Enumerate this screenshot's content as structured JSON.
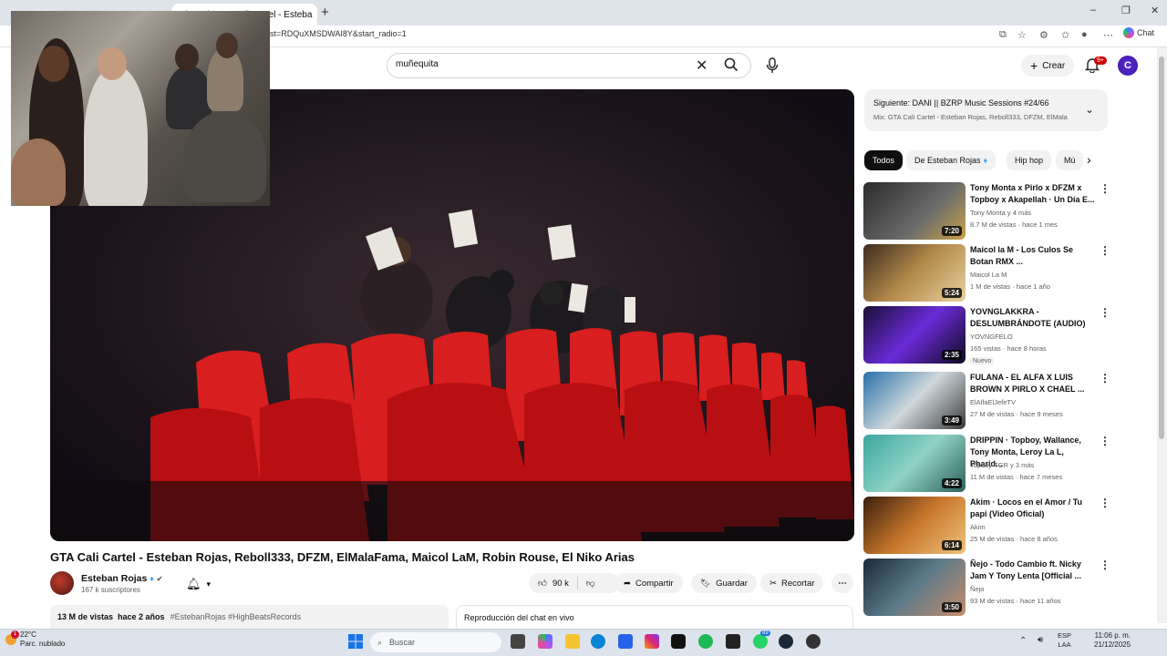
{
  "browser": {
    "tabs": [
      {
        "label": "...",
        "active": false
      },
      {
        "label": "(2137) GTA Cali Cartel - Esteba",
        "active": true
      }
    ],
    "url": "st=RDQuXMSDWAI8Y&start_radio=1",
    "chat_label": "Chat"
  },
  "youtube": {
    "search": {
      "value": "muñequita"
    },
    "create_label": "Crear",
    "notif_count": "9+",
    "avatar_letter": "C"
  },
  "video": {
    "title": "GTA Cali Cartel - Esteban Rojas, Reboll333, DFZM, ElMalaFama, Maicol LaM, Robin Rouse, El Niko Arias",
    "channel": "Esteban Rojas",
    "subscribers": "167 k suscriptores",
    "likes": "90 k",
    "share_label": "Compartir",
    "save_label": "Guardar",
    "clip_label": "Recortar",
    "views_date": "13 M de vistas  hace 2 años",
    "hashtags": "#EstebanRojas #HighBeatsRecords",
    "chat_replay": "Reproducción del chat en vivo"
  },
  "upnext": {
    "title": "Siguiente: DANI || BZRP Music Sessions #24/66",
    "subtitle": "Mix: GTA Cali Cartel - Esteban Rojas, Reboll333, DFZM, ElMala"
  },
  "chips": [
    "Todos",
    "De Esteban Rojas",
    "Hip hop",
    "Mú"
  ],
  "related": [
    {
      "title": "Tony Monta x Pirlo x DFZM x Topboy x Akapellah · Un Día E...",
      "channel": "Tony Monta  y 4 más",
      "meta": "8.7 M de vistas · hace 1 mes",
      "duration": "7:20",
      "badge": ""
    },
    {
      "title": "Maicol la M - Los Culos Se Botan RMX ...",
      "channel": "Maicol La M",
      "meta": "1 M de vistas · hace 1 año",
      "duration": "5:24",
      "badge": ""
    },
    {
      "title": "YOVNGLAKKRA - DESLUMBRÁNDOTE (AUDIO)",
      "channel": "YOVNGFELO",
      "meta": "165 vistas · hace 8 horas",
      "duration": "2:35",
      "badge": "Nuevo"
    },
    {
      "title": "FULANA - EL ALFA X LUIS BROWN X PIRLO X CHAEL ...",
      "channel": "ElAlfaElJefeTV",
      "meta": "27 M de vistas · hace 9 meses",
      "duration": "3:49",
      "badge": ""
    },
    {
      "title": "DRIPPIN · Topboy, Wallance, Tony Monta, Leroy La L, Pharid...",
      "channel": "Topboy TGR  y 3 más",
      "meta": "11 M de vistas · hace 7 meses",
      "duration": "4:22",
      "badge": ""
    },
    {
      "title": "Akim · Locos en el Amor / Tu papi (Video Oficial)",
      "channel": "Akim",
      "meta": "25 M de vistas · hace 8 años",
      "duration": "6:14",
      "badge": ""
    },
    {
      "title": "Ñejo - Todo Cambio ft. Nicky Jam Y Tony Lenta [Official ...",
      "channel": "Ñejo",
      "meta": "93 M de vistas · hace 11 años",
      "duration": "3:50",
      "badge": ""
    }
  ],
  "taskbar": {
    "weather_temp": "22°C",
    "weather_desc": "Parc. nublado",
    "search_placeholder": "Buscar",
    "lang": "ESP",
    "lang2": "LAA",
    "time": "11:06 p. m.",
    "date": "21/12/2025",
    "whatsapp_badge": "89"
  },
  "colors": {
    "accent": "#cc0000",
    "chip_active": "#0f0f0f"
  }
}
